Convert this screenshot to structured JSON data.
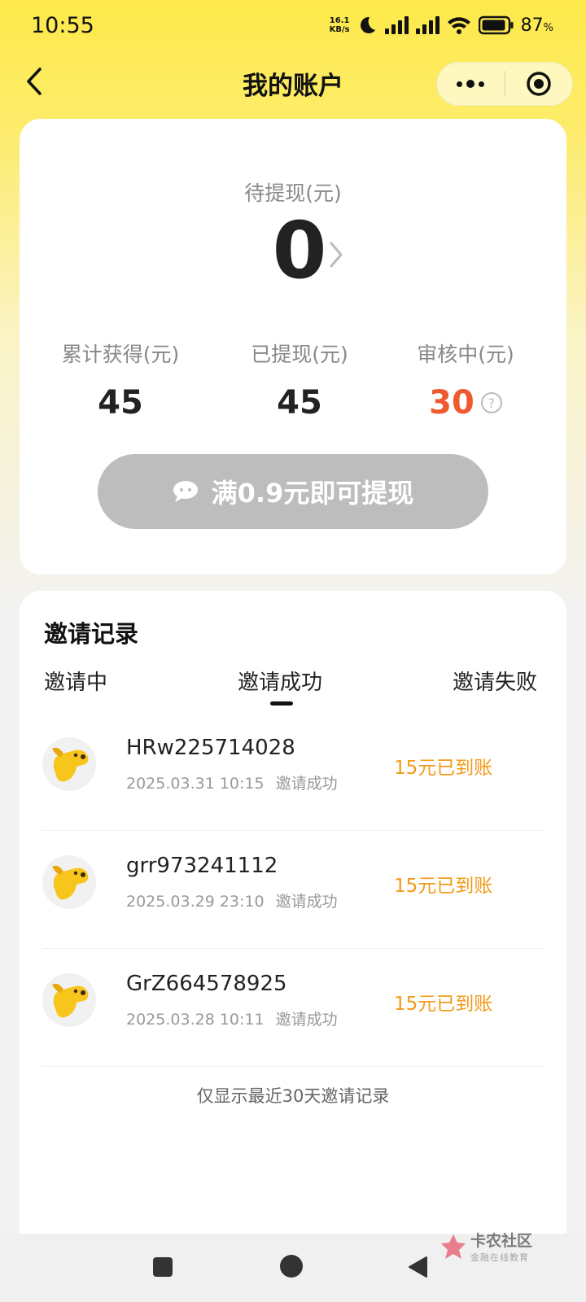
{
  "status_bar": {
    "time": "10:55",
    "net_speed_value": "16.1",
    "net_speed_unit": "KB/s",
    "battery_percent": "87",
    "percent_sign": "%"
  },
  "nav": {
    "title": "我的账户"
  },
  "account": {
    "pending_label": "待提现(元)",
    "pending_value": "0",
    "stats": [
      {
        "label": "累计获得(元)",
        "value": "45"
      },
      {
        "label": "已提现(元)",
        "value": "45"
      },
      {
        "label": "审核中(元)",
        "value": "30"
      }
    ],
    "withdraw_button_label": "满0.9元即可提现",
    "help_icon_glyph": "?"
  },
  "invite": {
    "title": "邀请记录",
    "tabs": [
      "邀请中",
      "邀请成功",
      "邀请失败"
    ],
    "active_tab": "邀请成功",
    "records": [
      {
        "name": "HRw225714028",
        "date": "2025.03.31 10:15",
        "status": "邀请成功",
        "reward": "15元已到账"
      },
      {
        "name": "grr973241112",
        "date": "2025.03.29 23:10",
        "status": "邀请成功",
        "reward": "15元已到账"
      },
      {
        "name": "GrZ664578925",
        "date": "2025.03.28 10:11",
        "status": "邀请成功",
        "reward": "15元已到账"
      }
    ],
    "footer_note": "仅显示最近30天邀请记录"
  },
  "watermark": {
    "main": "卡农社区",
    "sub": "金融在线教育"
  },
  "colors": {
    "accent_yellow": "#fde94a",
    "review_red": "#ee5a2f",
    "reward_orange": "#f29a18",
    "button_gray": "#bdbdbd"
  }
}
